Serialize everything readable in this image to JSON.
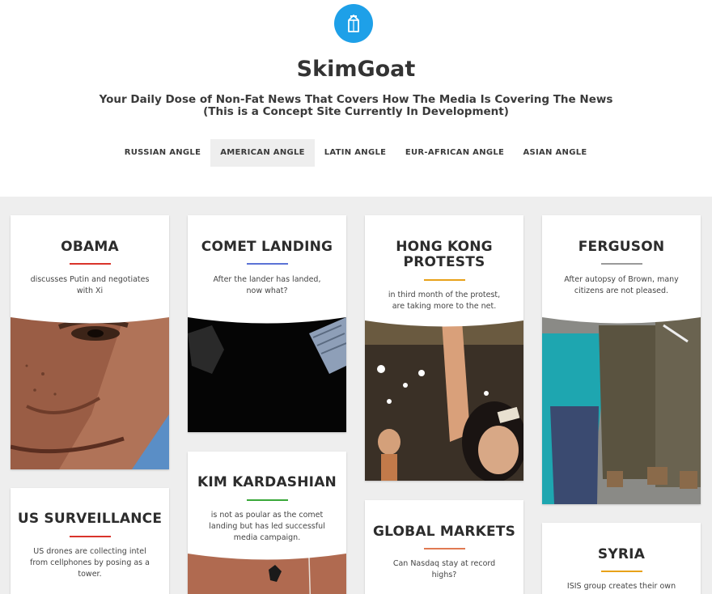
{
  "site": {
    "title": "SkimGoat",
    "tagline_line1": "Your Daily Dose of Non-Fat News That Covers How The Media Is Covering The News",
    "tagline_line2": "(This is a Concept Site Currently In Development)",
    "logo_icon": "milk-carton-icon",
    "brand_color": "#1ea0e8"
  },
  "nav": {
    "items": [
      {
        "label": "RUSSIAN ANGLE"
      },
      {
        "label": "AMERICAN ANGLE",
        "active": true
      },
      {
        "label": "LATIN ANGLE"
      },
      {
        "label": "EUR-AFRICAN ANGLE"
      },
      {
        "label": "ASIAN ANGLE"
      }
    ]
  },
  "cards": [
    {
      "title": "OBAMA",
      "desc_line1": "discusses Putin and negotiates",
      "desc_line2": "with Xi",
      "rule_color": "#d9342b"
    },
    {
      "title": "COMET LANDING",
      "desc_line1": "After the lander has landed,",
      "desc_line2": "now what?",
      "rule_color": "#5b73d6"
    },
    {
      "title_line1": "HONG KONG",
      "title_line2": "PROTESTS",
      "desc_line1": "in third month of the protest,",
      "desc_line2": "are taking more to the net.",
      "rule_color": "#e8a21a"
    },
    {
      "title": "FERGUSON",
      "desc_line1": "After autopsy of Brown, many",
      "desc_line2": "citizens are not pleased.",
      "rule_color": "#9a9a9a"
    },
    {
      "title": "US SURVEILLANCE",
      "desc_line1": "US drones are collecting intel",
      "desc_line2": "from cellphones by posing as a",
      "desc_line3": "tower.",
      "rule_color": "#d9342b"
    },
    {
      "title": "KIM KARDASHIAN",
      "desc_line1": "is not as poular as the comet",
      "desc_line2": "landing but has led successful",
      "desc_line3": "media campaign.",
      "rule_color": "#3aa83a"
    },
    {
      "title": "GLOBAL MARKETS",
      "desc_line1": "Can Nasdaq stay at record",
      "desc_line2": "highs?",
      "rule_color": "#e07a52"
    },
    {
      "title": "SYRIA",
      "desc_line1": "ISIS group creates their own",
      "rule_color": "#e8a21a"
    }
  ]
}
